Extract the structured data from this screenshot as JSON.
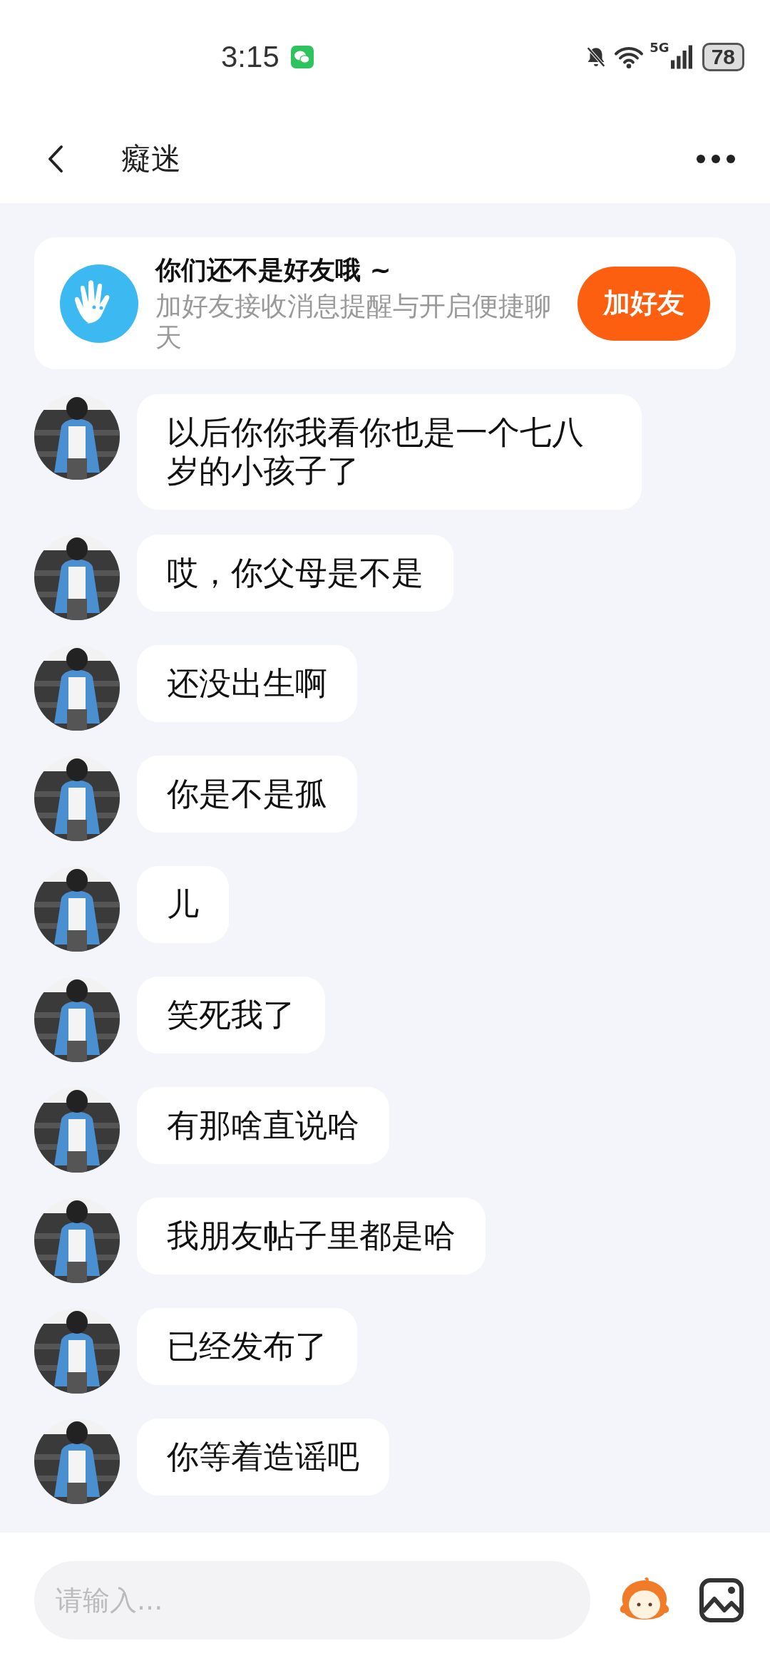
{
  "status_bar": {
    "time": "3:15",
    "network": "5G",
    "battery": "78"
  },
  "header": {
    "title": "癡迷"
  },
  "friend_banner": {
    "title": "你们还不是好友哦 ~",
    "subtitle": "加好友接收消息提醒与开启便捷聊天",
    "button": "加好友"
  },
  "messages": [
    {
      "text": "以后你你我看你也是一个七八岁的小孩子了"
    },
    {
      "text": "哎，你父母是不是"
    },
    {
      "text": "还没出生啊"
    },
    {
      "text": "你是不是孤"
    },
    {
      "text": "儿"
    },
    {
      "text": "笑死我了"
    },
    {
      "text": "有那啥直说哈"
    },
    {
      "text": "我朋友帖子里都是哈"
    },
    {
      "text": "已经发布了"
    },
    {
      "text": "你等着造谣吧"
    }
  ],
  "input": {
    "placeholder": "请输入..."
  }
}
